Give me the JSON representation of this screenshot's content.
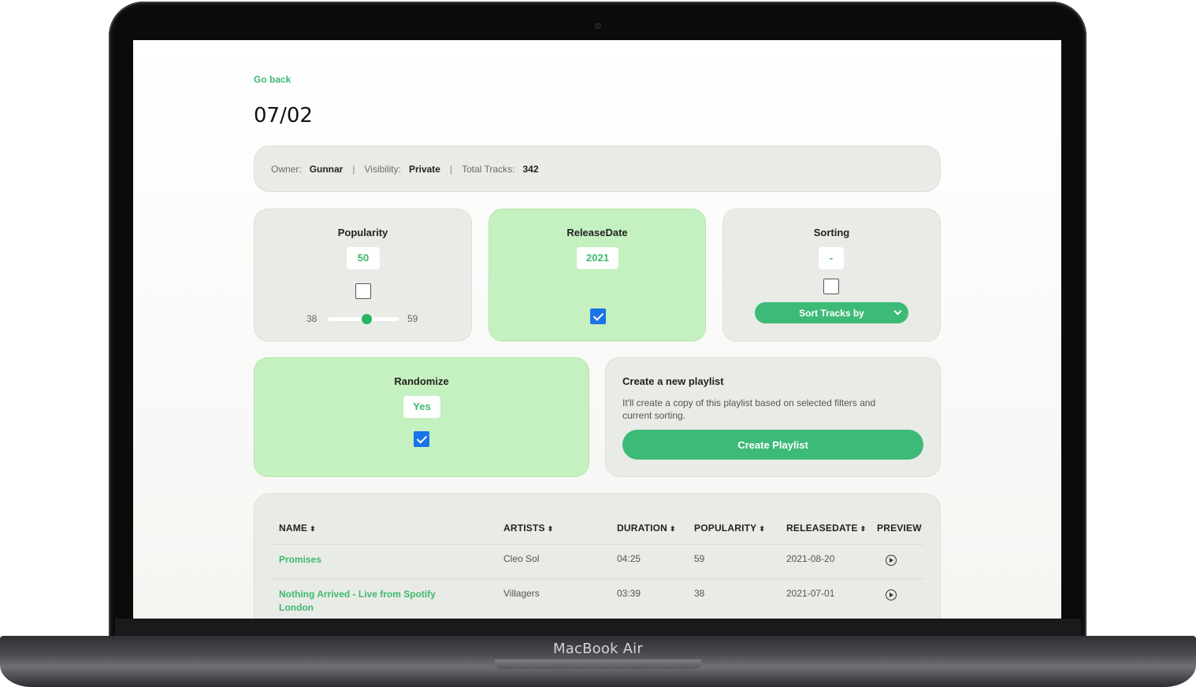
{
  "device": {
    "brand_label": "MacBook Air"
  },
  "nav": {
    "go_back_label": "Go back"
  },
  "page": {
    "title": "07/02"
  },
  "info": {
    "owner_label": "Owner:",
    "owner_value": "Gunnar",
    "visibility_label": "Visibility:",
    "visibility_value": "Private",
    "total_tracks_label": "Total Tracks:",
    "total_tracks_value": "342",
    "separator": "|"
  },
  "filters": {
    "popularity": {
      "title": "Popularity",
      "value": "50",
      "checked": false,
      "range_min": "38",
      "range_max": "59",
      "level": 0.55
    },
    "release_date": {
      "title": "ReleaseDate",
      "value": "2021",
      "checked": true
    },
    "sorting": {
      "title": "Sorting",
      "value": "-",
      "checked": false,
      "select_label": "Sort Tracks by"
    },
    "randomize": {
      "title": "Randomize",
      "value": "Yes",
      "checked": true
    }
  },
  "create": {
    "title": "Create a new playlist",
    "description": "It'll create a copy of this playlist based on selected filters and current sorting.",
    "button_label": "Create Playlist"
  },
  "table": {
    "headers": [
      "NAME",
      "ARTISTS",
      "DURATION",
      "POPULARITY",
      "RELEASEDATE",
      "PREVIEW"
    ],
    "rows": [
      {
        "name": "Promises",
        "artists": "Cleo Sol",
        "duration": "04:25",
        "popularity": "59",
        "release_date": "2021-08-20",
        "preview_icon": "play-circle-icon"
      },
      {
        "name": "Nothing Arrived - Live from Spotify London",
        "artists": "Villagers",
        "duration": "03:39",
        "popularity": "38",
        "release_date": "2021-07-01",
        "preview_icon": "play-circle-icon"
      }
    ]
  },
  "colors": {
    "accent": "#3dba6f",
    "button": "#3dba78",
    "active_card": "#c5f0bf",
    "card": "#e9ebe6",
    "checkbox": "#1a73e8"
  }
}
